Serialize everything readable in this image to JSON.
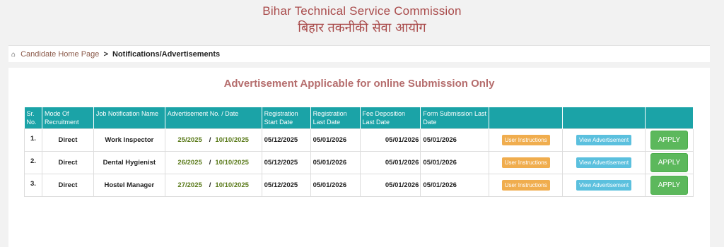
{
  "header": {
    "title_en": "Bihar Technical Service Commission",
    "title_hi": "बिहार तकनीकी सेवा आयोग"
  },
  "breadcrumb": {
    "home_icon": "home-icon",
    "home_label": "Candidate Home Page",
    "separator": ">",
    "current": "Notifications/Advertisements"
  },
  "panel": {
    "heading": "Advertisement Applicable for online Submission Only"
  },
  "table": {
    "headers": [
      "Sr. No.",
      "Mode Of Recruitment",
      "Job Notification Name",
      "Advertisement No. / Date",
      "Registration Start Date",
      "Registration Last Date",
      "Fee Deposition Last Date",
      "Form Submission Last Date",
      "",
      "",
      ""
    ],
    "rows": [
      {
        "sr": "1.",
        "mode": "Direct",
        "job": "Work Inspector",
        "adv_no": "25/2025",
        "adv_sep": "/",
        "adv_date": "10/10/2025",
        "reg_start": "05/12/2025",
        "reg_last": "05/01/2026",
        "fee_last": "05/01/2026",
        "form_last": "05/01/2026",
        "btn_instructions": "User Instructions",
        "btn_view": "View Advertisement",
        "btn_apply": "APPLY"
      },
      {
        "sr": "2.",
        "mode": "Direct",
        "job": "Dental Hygienist",
        "adv_no": "26/2025",
        "adv_sep": "/",
        "adv_date": "10/10/2025",
        "reg_start": "05/12/2025",
        "reg_last": "05/01/2026",
        "fee_last": "05/01/2026",
        "form_last": "05/01/2026",
        "btn_instructions": "User Instructions",
        "btn_view": "View Advertisement",
        "btn_apply": "APPLY"
      },
      {
        "sr": "3.",
        "mode": "Direct",
        "job": "Hostel Manager",
        "adv_no": "27/2025",
        "adv_sep": "/",
        "adv_date": "10/10/2025",
        "reg_start": "05/12/2025",
        "reg_last": "05/01/2026",
        "fee_last": "05/01/2026",
        "form_last": "05/01/2026",
        "btn_instructions": "User Instructions",
        "btn_view": "View Advertisement",
        "btn_apply": "APPLY"
      }
    ]
  },
  "colors": {
    "title": "#a94b4b",
    "heading": "#b56d6d",
    "table_header": "#1ba3a7",
    "btn_instructions": "#f0ad4e",
    "btn_view": "#5bc0de",
    "btn_apply": "#5cb85c",
    "adv_green": "#5a7a1a"
  }
}
